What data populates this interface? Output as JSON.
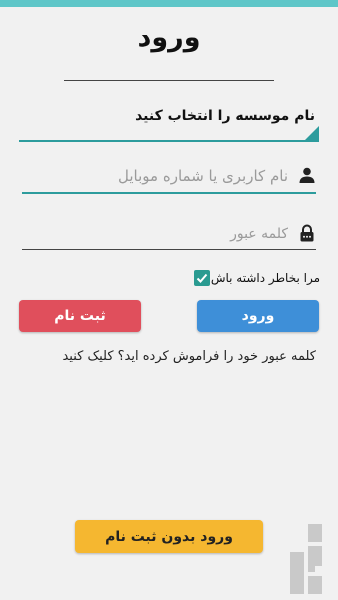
{
  "header": {
    "title": "ورود"
  },
  "institution_select": {
    "label": "نام موسسه را انتخاب کنید"
  },
  "username": {
    "placeholder": "نام کاربری یا شماره موبایل",
    "value": ""
  },
  "password": {
    "placeholder": "کلمه عبور",
    "value": ""
  },
  "remember": {
    "label": "مرا بخاطر داشته باش",
    "checked": true
  },
  "buttons": {
    "login": "ورود",
    "signup": "ثبت نام",
    "guest": "ورود بدون ثبت نام"
  },
  "forgot_link": "کلمه عبور خود را فراموش کرده اید؟ کلیک کنید",
  "colors": {
    "accent": "#2d9c9d",
    "login": "#3e8fd8",
    "signup": "#e04f5c",
    "guest": "#f5b730",
    "topbar": "#5ec6c8"
  },
  "icons": {
    "username": "person-icon",
    "password": "lock-icon",
    "checkbox": "checkmark-icon"
  }
}
